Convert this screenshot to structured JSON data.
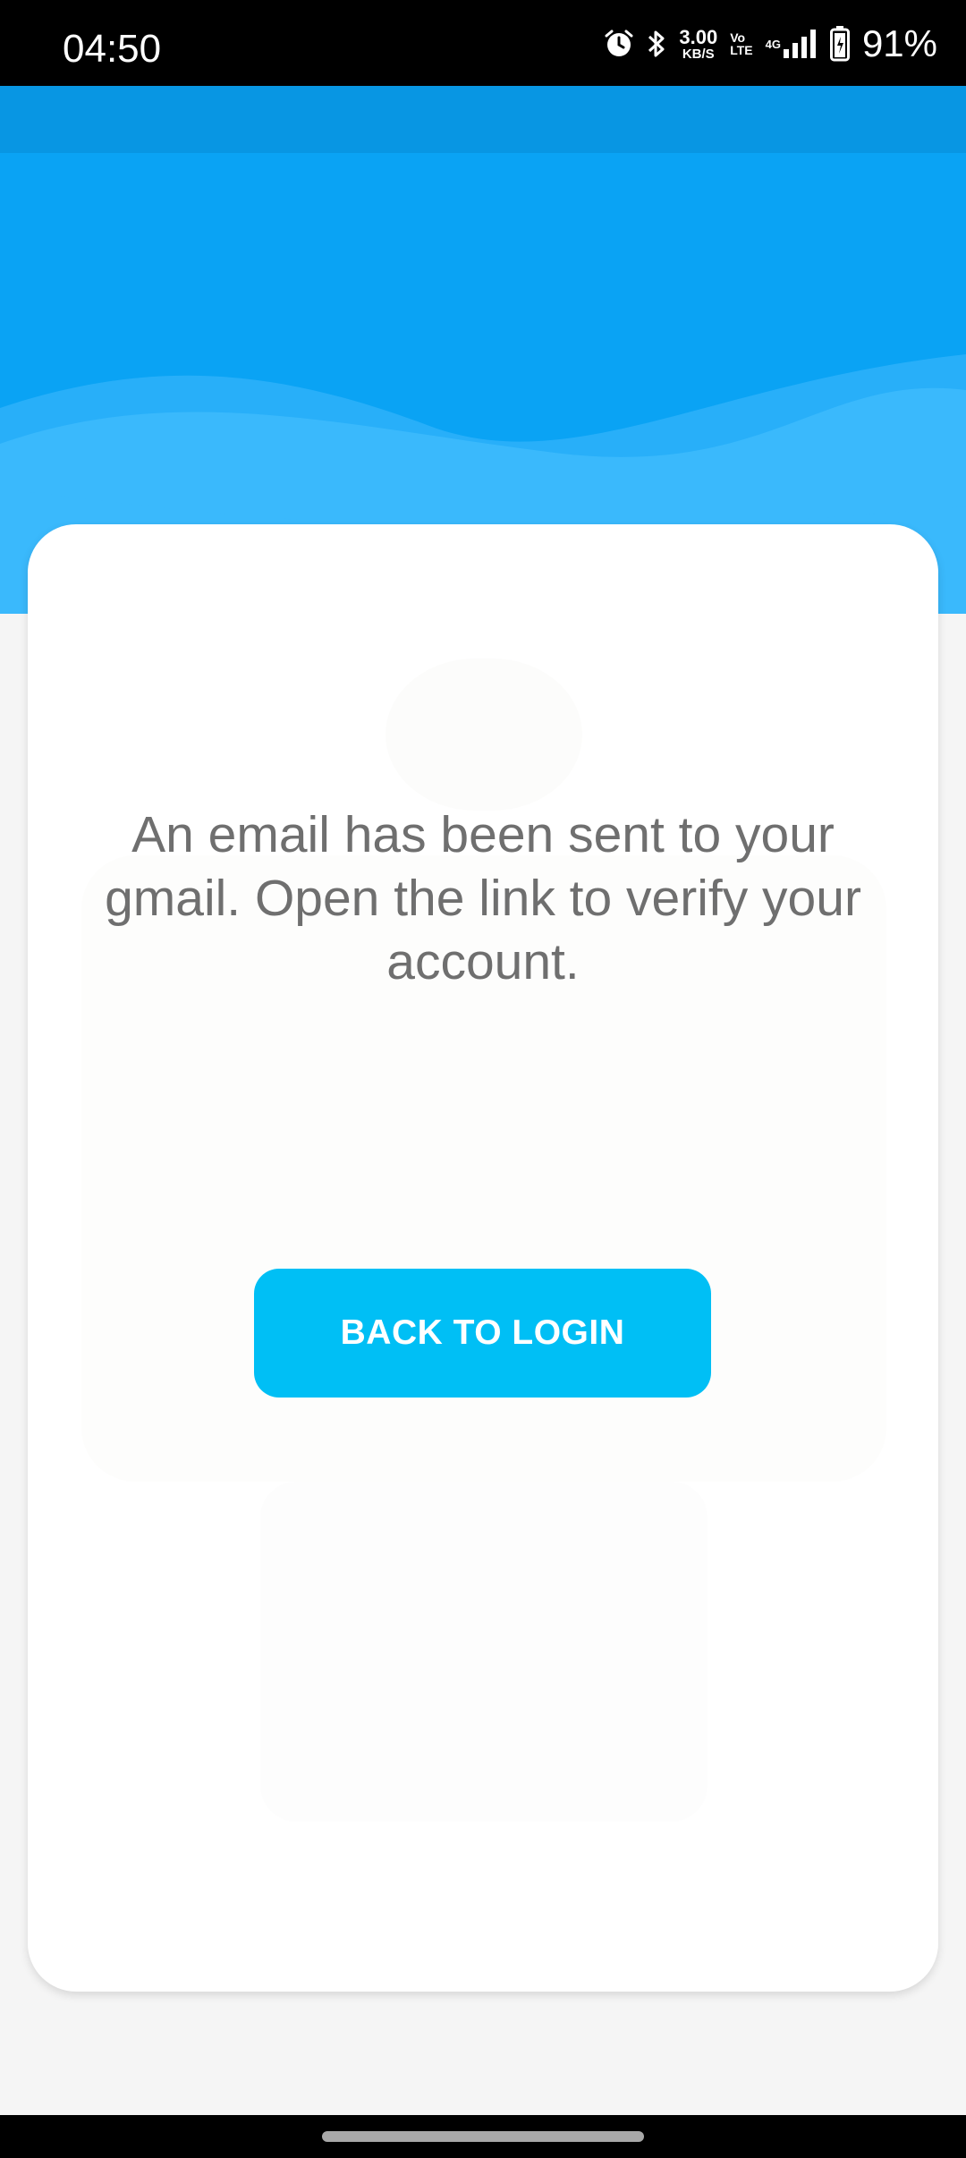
{
  "status_bar": {
    "time": "04:50",
    "net_speed_value": "3.00",
    "net_speed_unit": "KB/S",
    "volte_top": "Vo",
    "volte_bottom": "LTE",
    "network_type": "4G",
    "battery_percent": "91%",
    "icons": [
      "alarm-icon",
      "bluetooth-icon",
      "signal-icon",
      "battery-icon"
    ]
  },
  "content": {
    "message": "An email has been sent to your gmail. Open the link to verify your account.",
    "button_label": "BACK TO LOGIN"
  },
  "colors": {
    "header_blue": "#0ea5f5",
    "wave_light": "#36b6fb",
    "button": "#00bff5",
    "message_text": "#6f6f6f",
    "page_bg": "#f5f5f5"
  }
}
